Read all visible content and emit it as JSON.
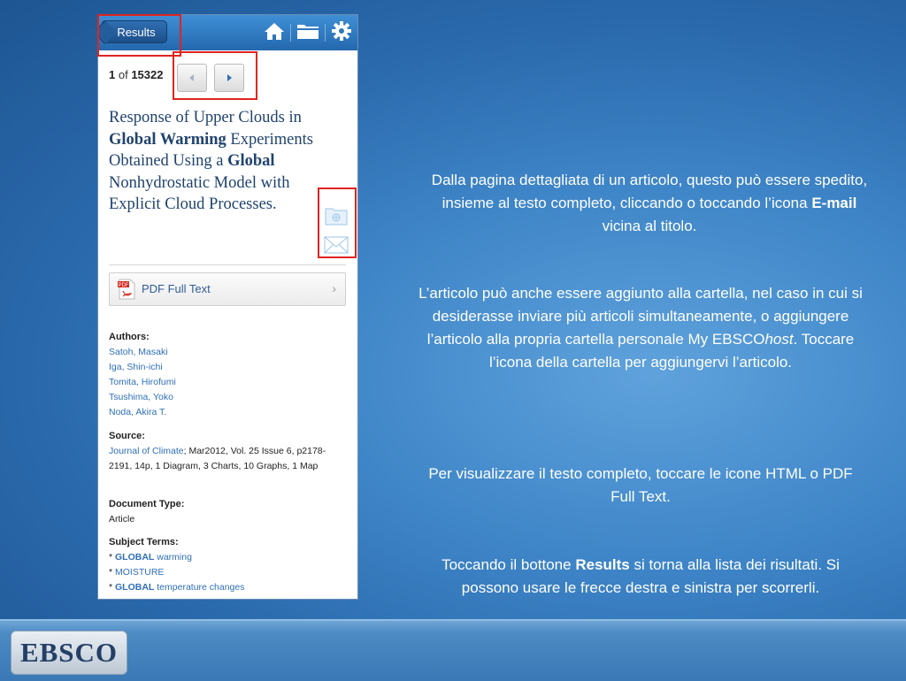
{
  "phone": {
    "results_label": "Results",
    "pager": {
      "current": "1",
      "of_label": "of",
      "total": "15322"
    },
    "title_parts": [
      {
        "text": "Response of Upper Clouds in ",
        "bold": false
      },
      {
        "text": "Global Warming",
        "bold": true
      },
      {
        "text": " Experiments Obtained Using a ",
        "bold": false
      },
      {
        "text": "Global",
        "bold": true
      },
      {
        "text": " Nonhydrostatic Model with Explicit Cloud Processes",
        "bold": false
      },
      {
        "text": ".",
        "bold": false
      }
    ],
    "pdf_label": "PDF Full Text",
    "authors_heading": "Authors:",
    "authors": [
      "Satoh, Masaki",
      "Iga, Shin-ichi",
      "Tomita, Hirofumi",
      "Tsushima, Yoko",
      "Noda, Akira T."
    ],
    "source_heading": "Source:",
    "source_journal": "Journal of Climate",
    "source_rest": "; Mar2012, Vol. 25 Issue 6, p2178-2191, 14p, 1 Diagram, 3 Charts, 10 Graphs, 1 Map",
    "doctype_heading": "Document Type:",
    "doctype_value": "Article",
    "subject_heading": "Subject Terms:",
    "subjects": [
      {
        "bold": "GLOBAL",
        "rest": " warming"
      },
      {
        "bold": "",
        "rest": "MOISTURE"
      },
      {
        "bold": "GLOBAL",
        "rest": " temperature changes"
      }
    ],
    "bullet": "*",
    "colors": {
      "topbar": "#2f7cc6",
      "highlight": "#e0241f",
      "title": "#20436e",
      "link": "#2f6fb8"
    }
  },
  "explanations": {
    "p1_before": "Dalla pagina dettagliata di un articolo, questo può essere spedito, insieme al testo completo, cliccando o toccando l’icona ",
    "p1_bold": "E-mail",
    "p1_after": " vicina al titolo.",
    "p2_before": "L’articolo può anche essere aggiunto alla cartella, nel caso in cui si desiderasse inviare più articoli simultaneamente, o aggiungere l’articolo alla propria cartella personale My EBSCO",
    "p2_italic": "host",
    "p2_after": ". Toccare l’icona della cartella per aggiungervi l’articolo.",
    "p3": "Per visualizzare il testo completo, toccare le icone HTML o PDF Full Text.",
    "p4_before": "Toccando il bottone ",
    "p4_bold": "Results",
    "p4_after": " si torna alla lista dei risultati. Si possono usare le frecce destra e sinistra per scorrerli."
  },
  "logo": {
    "text": "EBSCO"
  },
  "icons": [
    "home-icon",
    "folder-icon",
    "gear-icon",
    "left-arrow-icon",
    "right-arrow-icon",
    "add-to-folder-icon",
    "email-icon",
    "pdf-icon",
    "chevron-right-icon"
  ]
}
